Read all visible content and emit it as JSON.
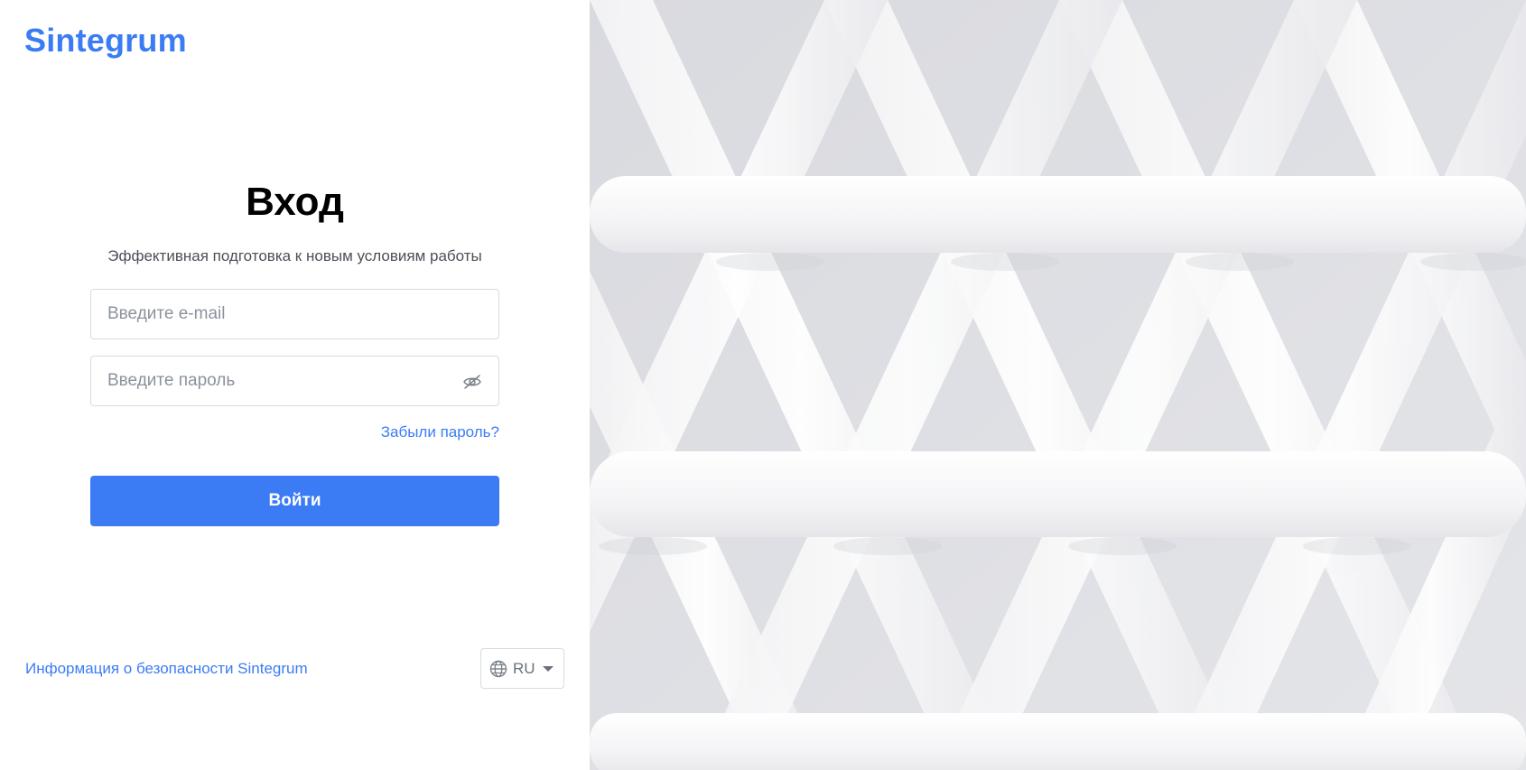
{
  "brand": {
    "name": "Sintegrum",
    "color": "#3b7cf5"
  },
  "login": {
    "title": "Вход",
    "subtitle": "Эффективная подготовка к новым условиям работы",
    "email_placeholder": "Введите e-mail",
    "password_placeholder": "Введите пароль",
    "forgot_password": "Забыли пароль?",
    "submit_label": "Войти"
  },
  "footer": {
    "security_link": "Информация о безопасности Sintegrum",
    "language": {
      "selected": "RU",
      "icon": "globe-icon"
    }
  },
  "icons": {
    "password_toggle": "eye-off-icon",
    "language_dropdown": "caret-down-icon"
  },
  "background_image": "woven-white-pattern"
}
